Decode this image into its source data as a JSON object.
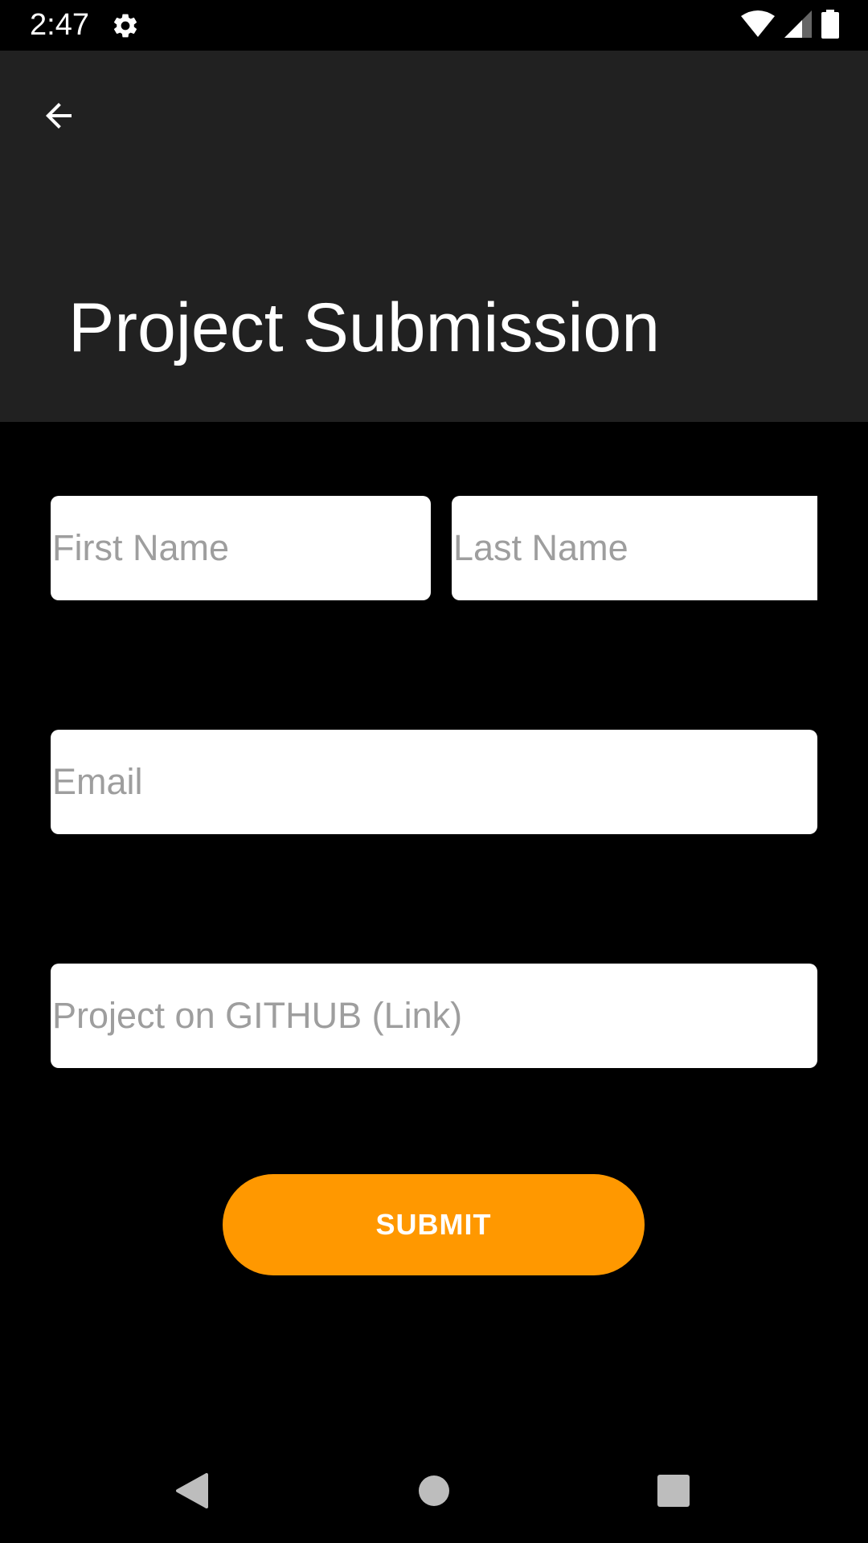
{
  "status_bar": {
    "time": "2:47",
    "icons": [
      "gear-icon",
      "wifi-icon",
      "signal-icon",
      "battery-icon"
    ]
  },
  "app_bar": {
    "back_icon": "arrow-left-icon",
    "title": "Project Submission",
    "background": "#212121"
  },
  "form": {
    "first_name": {
      "placeholder": "First Name",
      "value": ""
    },
    "last_name": {
      "placeholder": "Last Name",
      "value": ""
    },
    "email": {
      "placeholder": "Email",
      "value": ""
    },
    "github": {
      "placeholder": "Project on GITHUB (Link)",
      "value": ""
    },
    "submit_label": "SUBMIT",
    "submit_color": "#ff9800"
  },
  "nav_bar": {
    "icons": [
      "nav-back-icon",
      "nav-home-icon",
      "nav-recents-icon"
    ]
  }
}
